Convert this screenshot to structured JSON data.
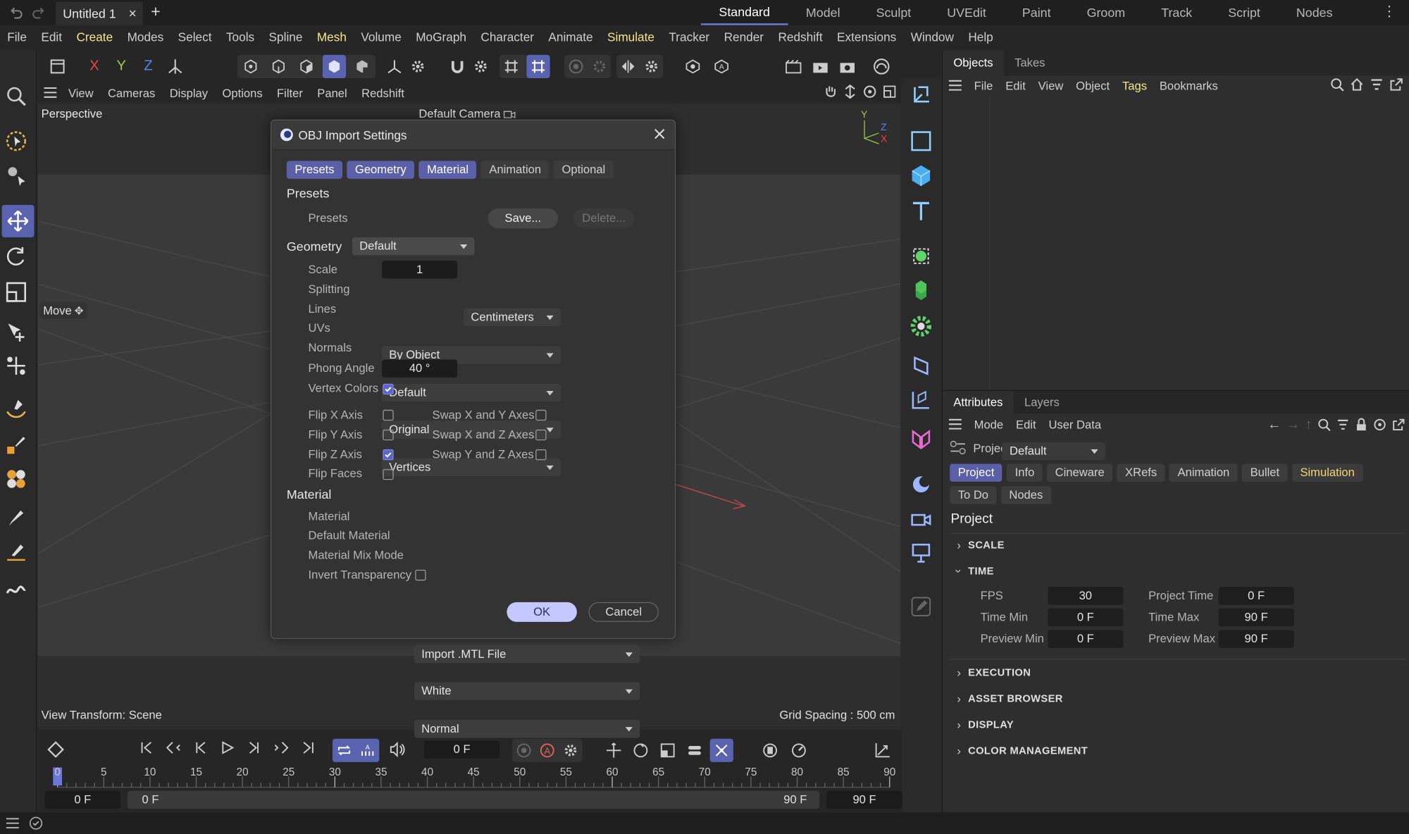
{
  "title_bar": {
    "tab": "Untitled 1",
    "close": "×",
    "add": "+",
    "layouts": [
      "Standard",
      "Model",
      "Sculpt",
      "UVEdit",
      "Paint",
      "Groom",
      "Track",
      "Script",
      "Nodes"
    ],
    "active_layout": "Standard"
  },
  "menu": [
    "File",
    "Edit",
    "Create",
    "Modes",
    "Select",
    "Tools",
    "Spline",
    "Mesh",
    "Volume",
    "MoGraph",
    "Character",
    "Animate",
    "Simulate",
    "Tracker",
    "Render",
    "Redshift",
    "Extensions",
    "Window",
    "Help"
  ],
  "highlighted_menus": [
    "Create",
    "Mesh",
    "Simulate"
  ],
  "axes": {
    "x": "X",
    "y": "Y",
    "z": "Z"
  },
  "viewport_menu": [
    "View",
    "Cameras",
    "Display",
    "Options",
    "Filter",
    "Panel",
    "Redshift"
  ],
  "viewport": {
    "name": "Perspective",
    "camera": "Default Camera",
    "move_label": "Move",
    "view_transform": "View Transform: Scene",
    "grid_spacing": "Grid Spacing : 500 cm",
    "gizmo": {
      "y": "Y",
      "z": "Z",
      "x": "X"
    }
  },
  "dialog": {
    "title": "OBJ Import Settings",
    "tabs": [
      {
        "label": "Presets",
        "on": true
      },
      {
        "label": "Geometry",
        "on": true
      },
      {
        "label": "Material",
        "on": true
      },
      {
        "label": "Animation",
        "on": false
      },
      {
        "label": "Optional",
        "on": false
      }
    ],
    "presets": {
      "section": "Presets",
      "label": "Presets",
      "value": "Default",
      "save": "Save...",
      "delete": "Delete..."
    },
    "geometry": {
      "section": "Geometry",
      "scale_label": "Scale",
      "scale": "1",
      "unit": "Centimeters",
      "splitting_label": "Splitting",
      "splitting": "By Object",
      "lines_label": "Lines",
      "lines": "Default",
      "uvs_label": "UVs",
      "uvs": "Original",
      "normals_label": "Normals",
      "normals": "Vertices",
      "phong_label": "Phong Angle",
      "phong": "40 °",
      "vertex_colors_label": "Vertex Colors",
      "flip_x": "Flip X Axis",
      "flip_y": "Flip Y Axis",
      "flip_z": "Flip Z Axis",
      "flip_faces": "Flip Faces",
      "swap_xy": "Swap X and Y Axes",
      "swap_xz": "Swap X and Z Axes",
      "swap_yz": "Swap Y and Z Axes"
    },
    "material": {
      "section": "Material",
      "material_label": "Material",
      "material": "Import .MTL File",
      "default_label": "Default Material",
      "default": "White",
      "mix_label": "Material Mix Mode",
      "mix": "Normal",
      "invert_label": "Invert Transparency"
    },
    "ok": "OK",
    "cancel": "Cancel"
  },
  "objects_panel": {
    "tabs": [
      "Objects",
      "Takes"
    ],
    "menu": [
      "File",
      "Edit",
      "View",
      "Object",
      "Tags",
      "Bookmarks"
    ],
    "highlighted": "Tags"
  },
  "attributes_panel": {
    "tabs": [
      "Attributes",
      "Layers"
    ],
    "menu": [
      "Mode",
      "Edit",
      "User Data"
    ],
    "context": "Project",
    "preset": "Default",
    "chips_row1": [
      "Project",
      "Info",
      "Cineware",
      "XRefs",
      "Animation",
      "Bullet",
      "Simulation"
    ],
    "chips_row2": [
      "To Do",
      "Nodes"
    ],
    "title": "Project",
    "sections": [
      "SCALE",
      "TIME",
      "EXECUTION",
      "ASSET BROWSER",
      "DISPLAY",
      "COLOR MANAGEMENT"
    ],
    "time": {
      "fps_label": "FPS",
      "fps": "30",
      "ptime_label": "Project Time",
      "ptime": "0 F",
      "tmin_label": "Time Min",
      "tmin": "0 F",
      "tmax_label": "Time Max",
      "tmax": "90 F",
      "pmin_label": "Preview Min",
      "pmin": "0 F",
      "pmax_label": "Preview Max",
      "pmax": "90 F"
    }
  },
  "timeline": {
    "current": "0 F",
    "ticks": [
      "0",
      "5",
      "10",
      "15",
      "20",
      "25",
      "30",
      "35",
      "40",
      "45",
      "50",
      "55",
      "60",
      "65",
      "70",
      "75",
      "80",
      "85",
      "90"
    ],
    "start": "0 F",
    "range_start": "0 F",
    "range_end": "90 F",
    "end": "90 F"
  },
  "colors": {
    "accent": "#5a63b0",
    "highlight": "#f1d679"
  }
}
